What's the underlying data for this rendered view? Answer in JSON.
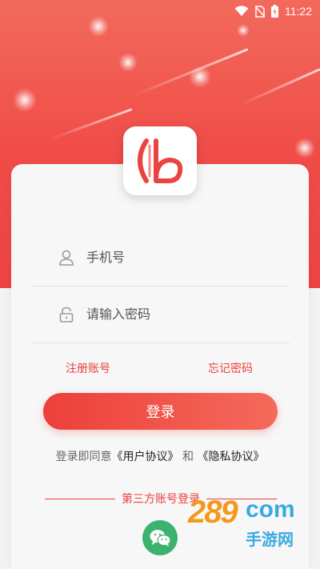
{
  "status_bar": {
    "time": "11:22",
    "icons": [
      "wifi-icon",
      "no-sim-icon",
      "battery-charging-icon"
    ]
  },
  "app": {
    "logo": "app-logo"
  },
  "form": {
    "phone": {
      "placeholder": "手机号",
      "value": "",
      "icon": "user-icon"
    },
    "password": {
      "placeholder": "请输入密码",
      "value": "",
      "icon": "lock-icon"
    },
    "register_link": "注册账号",
    "forgot_link": "忘记密码",
    "login_button": "登录"
  },
  "agreement": {
    "prefix": "登录即同意",
    "user_protocol": "《用户协议》",
    "and": "和",
    "privacy_protocol": "《隐私协议》"
  },
  "third_party": {
    "title": "第三方账号登录",
    "wechat_icon": "wechat-icon"
  },
  "watermark": {
    "brand": "289",
    "suffix": "com",
    "subtitle": "手游网"
  },
  "colors": {
    "accent": "#ed3f3c",
    "hero_top": "#f26a5c",
    "hero_bottom": "#ee4344",
    "wechat": "#3bb36e"
  }
}
